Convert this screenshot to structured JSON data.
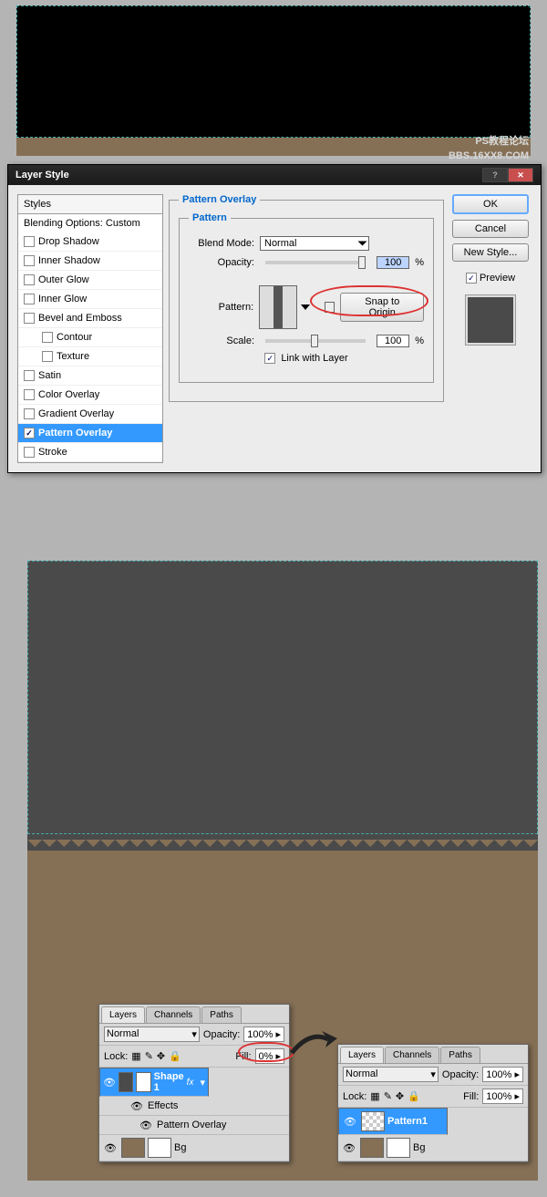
{
  "dialog": {
    "title": "Layer Style",
    "styles_header": "Styles",
    "blending": "Blending Options: Custom",
    "items": [
      {
        "label": "Drop Shadow",
        "checked": false,
        "sub": false
      },
      {
        "label": "Inner Shadow",
        "checked": false,
        "sub": false
      },
      {
        "label": "Outer Glow",
        "checked": false,
        "sub": false
      },
      {
        "label": "Inner Glow",
        "checked": false,
        "sub": false
      },
      {
        "label": "Bevel and Emboss",
        "checked": false,
        "sub": false
      },
      {
        "label": "Contour",
        "checked": false,
        "sub": true
      },
      {
        "label": "Texture",
        "checked": false,
        "sub": true
      },
      {
        "label": "Satin",
        "checked": false,
        "sub": false
      },
      {
        "label": "Color Overlay",
        "checked": false,
        "sub": false
      },
      {
        "label": "Gradient Overlay",
        "checked": false,
        "sub": false
      },
      {
        "label": "Pattern Overlay",
        "checked": true,
        "sub": false,
        "selected": true
      },
      {
        "label": "Stroke",
        "checked": false,
        "sub": false
      }
    ],
    "group_title": "Pattern Overlay",
    "inner_title": "Pattern",
    "blend_mode_label": "Blend Mode:",
    "blend_mode_value": "Normal",
    "opacity_label": "Opacity:",
    "opacity_value": "100",
    "pct": "%",
    "pattern_label": "Pattern:",
    "snap_btn": "Snap to Origin",
    "scale_label": "Scale:",
    "scale_value": "100",
    "link_label": "Link with Layer",
    "ok": "OK",
    "cancel": "Cancel",
    "new_style": "New Style...",
    "preview": "Preview"
  },
  "watermark": {
    "line1": "PS教程论坛",
    "line2": "BBS.16XX8.COM"
  },
  "panel1": {
    "tabs": [
      "Layers",
      "Channels",
      "Paths"
    ],
    "mode": "Normal",
    "opacity_lbl": "Opacity:",
    "opacity_val": "100%",
    "lock_lbl": "Lock:",
    "fill_lbl": "Fill:",
    "fill_val": "0%",
    "shape": "Shape 1",
    "effects": "Effects",
    "pov": "Pattern Overlay",
    "bg": "Bg",
    "fx": "fx"
  },
  "panel2": {
    "tabs": [
      "Layers",
      "Channels",
      "Paths"
    ],
    "mode": "Normal",
    "opacity_lbl": "Opacity:",
    "opacity_val": "100%",
    "lock_lbl": "Lock:",
    "fill_lbl": "Fill:",
    "fill_val": "100%",
    "pattern1": "Pattern1",
    "bg": "Bg"
  }
}
